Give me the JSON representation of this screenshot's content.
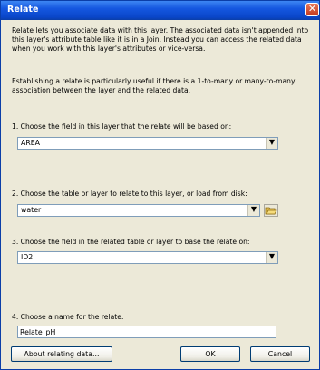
{
  "window": {
    "title": "Relate",
    "close_label": "✕"
  },
  "intro": {
    "p1": "Relate lets you associate data with this layer. The associated data isn't appended into this layer's attribute table like it is in a Join. Instead you can access the related data when you work with this layer's attributes or vice-versa.",
    "p2": "Establishing a relate is particularly useful if there is a 1-to-many or many-to-many association between the layer and the related data."
  },
  "step1": {
    "label": "1. Choose the field in this layer that the relate will be based on:",
    "value": "AREA"
  },
  "step2": {
    "label": "2. Choose the table or layer to relate to this layer, or load from disk:",
    "value": "water"
  },
  "step3": {
    "label": "3. Choose the field in the related table or layer to base the relate on:",
    "value": "ID2"
  },
  "step4": {
    "label": "4. Choose a name for the relate:",
    "value": "Relate_pH"
  },
  "buttons": {
    "about": "About relating data...",
    "ok": "OK",
    "cancel": "Cancel"
  },
  "icons": {
    "dropdown": "chevron-down-icon",
    "folder": "folder-open-icon",
    "close": "close-icon"
  },
  "colors": {
    "titlebar": "#0a46c9",
    "dialog_bg": "#ece9d8",
    "close_button": "#c4391e"
  }
}
